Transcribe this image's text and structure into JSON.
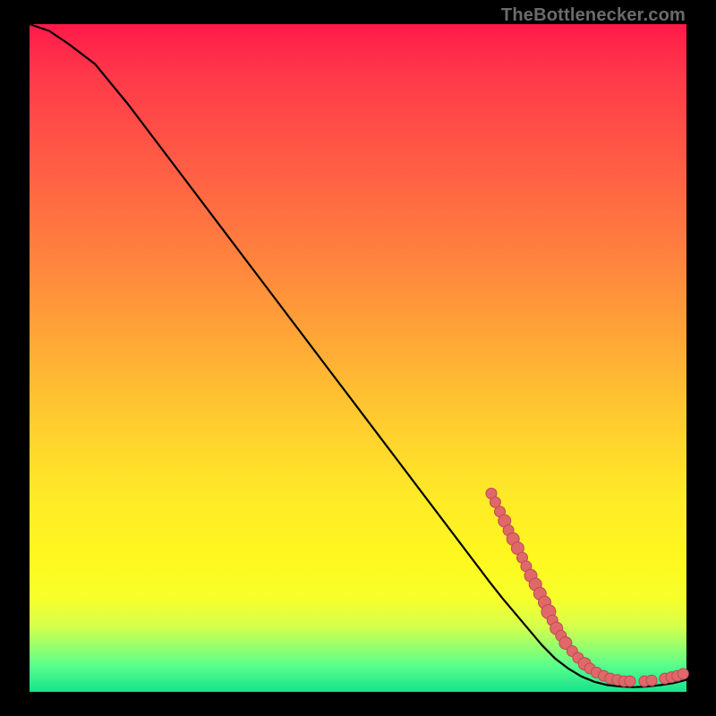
{
  "attribution": "TheBottlenecker.com",
  "colors": {
    "curve": "#000000",
    "marker_fill": "#e06868",
    "marker_stroke": "#bb4a58"
  },
  "chart_data": {
    "type": "line",
    "title": "",
    "xlabel": "",
    "ylabel": "",
    "xlim": [
      0,
      100
    ],
    "ylim": [
      0,
      100
    ],
    "series": [
      {
        "name": "curve",
        "x": [
          0,
          3,
          6,
          10,
          15,
          20,
          25,
          30,
          35,
          40,
          45,
          50,
          55,
          60,
          65,
          70,
          72,
          75,
          78,
          80,
          82,
          84,
          86,
          88,
          90,
          92,
          94,
          96,
          98,
          100
        ],
        "y": [
          100,
          99,
          97,
          94,
          88,
          81.5,
          75,
          68.5,
          62,
          55.5,
          49,
          42.5,
          36,
          29.5,
          23,
          16.5,
          14,
          10.5,
          7,
          5,
          3.5,
          2.3,
          1.5,
          1.0,
          0.8,
          0.7,
          0.8,
          1.0,
          1.3,
          1.8
        ]
      }
    ],
    "markers": {
      "note": "Salmon circular markers rendered along the lower-right portion of the curve.",
      "points": [
        {
          "x": 70.3,
          "y": 29.7,
          "r": 6
        },
        {
          "x": 70.9,
          "y": 28.4,
          "r": 6
        },
        {
          "x": 71.6,
          "y": 27.0,
          "r": 6
        },
        {
          "x": 72.3,
          "y": 25.6,
          "r": 7
        },
        {
          "x": 72.9,
          "y": 24.2,
          "r": 6
        },
        {
          "x": 73.6,
          "y": 22.9,
          "r": 7
        },
        {
          "x": 74.3,
          "y": 21.5,
          "r": 7
        },
        {
          "x": 75.0,
          "y": 20.1,
          "r": 6
        },
        {
          "x": 75.6,
          "y": 18.8,
          "r": 6
        },
        {
          "x": 76.3,
          "y": 17.4,
          "r": 7
        },
        {
          "x": 77.0,
          "y": 16.1,
          "r": 7
        },
        {
          "x": 77.7,
          "y": 14.7,
          "r": 7
        },
        {
          "x": 78.4,
          "y": 13.4,
          "r": 7
        },
        {
          "x": 79.0,
          "y": 12.0,
          "r": 8
        },
        {
          "x": 79.6,
          "y": 10.7,
          "r": 6
        },
        {
          "x": 80.2,
          "y": 9.5,
          "r": 7
        },
        {
          "x": 80.9,
          "y": 8.4,
          "r": 6
        },
        {
          "x": 81.6,
          "y": 7.3,
          "r": 7
        },
        {
          "x": 82.6,
          "y": 6.1,
          "r": 6
        },
        {
          "x": 83.5,
          "y": 5.1,
          "r": 6
        },
        {
          "x": 84.5,
          "y": 4.2,
          "r": 7
        },
        {
          "x": 85.3,
          "y": 3.5,
          "r": 6
        },
        {
          "x": 86.3,
          "y": 2.9,
          "r": 6
        },
        {
          "x": 87.4,
          "y": 2.4,
          "r": 6
        },
        {
          "x": 88.4,
          "y": 2.0,
          "r": 6
        },
        {
          "x": 89.5,
          "y": 1.8,
          "r": 6
        },
        {
          "x": 90.5,
          "y": 1.6,
          "r": 6
        },
        {
          "x": 91.4,
          "y": 1.6,
          "r": 6
        },
        {
          "x": 93.6,
          "y": 1.6,
          "r": 6
        },
        {
          "x": 94.7,
          "y": 1.7,
          "r": 6
        },
        {
          "x": 96.7,
          "y": 2.0,
          "r": 6
        },
        {
          "x": 97.7,
          "y": 2.2,
          "r": 6
        },
        {
          "x": 98.6,
          "y": 2.4,
          "r": 6
        },
        {
          "x": 99.5,
          "y": 2.7,
          "r": 6
        }
      ]
    }
  }
}
